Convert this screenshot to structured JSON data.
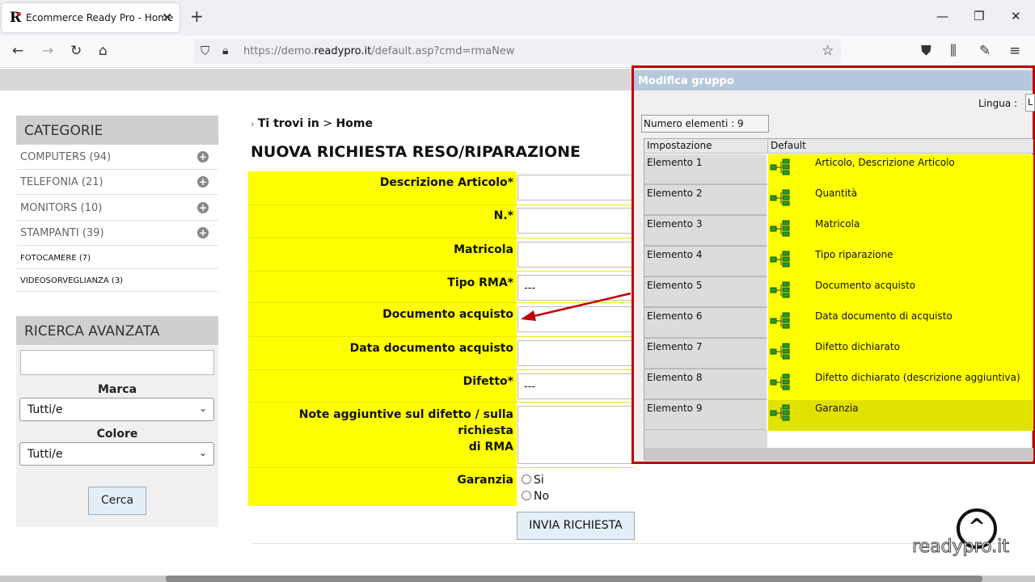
{
  "browser": {
    "tab_title": "Ecommerce Ready Pro - Home",
    "tab_logo": "R",
    "url_prefix": "https://demo.",
    "url_host": "readypro.it",
    "url_path": "/default.asp?cmd=rmaNew"
  },
  "sidebar": {
    "categories_title": "CATEGORIE",
    "categories": [
      {
        "label": "COMPUTERS (94)"
      },
      {
        "label": "TELEFONIA (21)"
      },
      {
        "label": "MONITORS (10)"
      },
      {
        "label": "STAMPANTI (39)"
      },
      {
        "label": "FOTOCAMERE (7)"
      },
      {
        "label": "VIDEOSORVEGLIANZA (3)"
      }
    ],
    "search_title": "RICERCA AVANZATA",
    "search_input_value": "",
    "brand_label": "Marca",
    "brand_value": "Tutti/e",
    "color_label": "Colore",
    "color_value": "Tutti/e",
    "search_button": "Cerca"
  },
  "main": {
    "breadcrumb_prefix": "Ti trovi in",
    "breadcrumb_sep": ">",
    "breadcrumb_current": "Home",
    "title": "NUOVA RICHIESTA RESO/RIPARAZIONE",
    "fields": {
      "descrizione": "Descrizione Articolo*",
      "numero": "N.*",
      "matricola": "Matricola",
      "tipo_rma": "Tipo RMA*",
      "tipo_rma_value": "---",
      "documento": "Documento acquisto",
      "data_documento": "Data documento acquisto",
      "difetto": "Difetto*",
      "difetto_value": "---",
      "note_line1": "Note aggiuntive sul difetto / sulla richiesta",
      "note_line2": "di RMA",
      "garanzia": "Garanzia",
      "garanzia_si": "Si",
      "garanzia_no": "No"
    },
    "submit_button": "INVIA RICHIESTA"
  },
  "panel": {
    "title": "Modifica gruppo",
    "lingua_label": "Lingua :",
    "lingua_value": "L",
    "count_label": "Numero elementi : 9",
    "col_setting": "Impostazione",
    "col_default": "Default",
    "rows": [
      {
        "name": "Elemento 1",
        "value": "Articolo, Descrizione Articolo"
      },
      {
        "name": "Elemento 2",
        "value": "Quantità"
      },
      {
        "name": "Elemento 3",
        "value": "Matricola"
      },
      {
        "name": "Elemento 4",
        "value": "Tipo riparazione"
      },
      {
        "name": "Elemento 5",
        "value": "Documento acquisto"
      },
      {
        "name": "Elemento 6",
        "value": "Data documento di acquisto"
      },
      {
        "name": "Elemento 7",
        "value": "Difetto dichiarato"
      },
      {
        "name": "Elemento 8",
        "value": "Difetto dichiarato (descrizione aggiuntiva)"
      },
      {
        "name": "Elemento 9",
        "value": "Garanzia"
      }
    ]
  },
  "footer": {
    "logo_caret": "^",
    "logo_text": "readypro.it"
  },
  "colors": {
    "form_highlight": "#ffff00",
    "annotation_red": "#c00000",
    "panel_titlebar": "#b6c8dc"
  }
}
